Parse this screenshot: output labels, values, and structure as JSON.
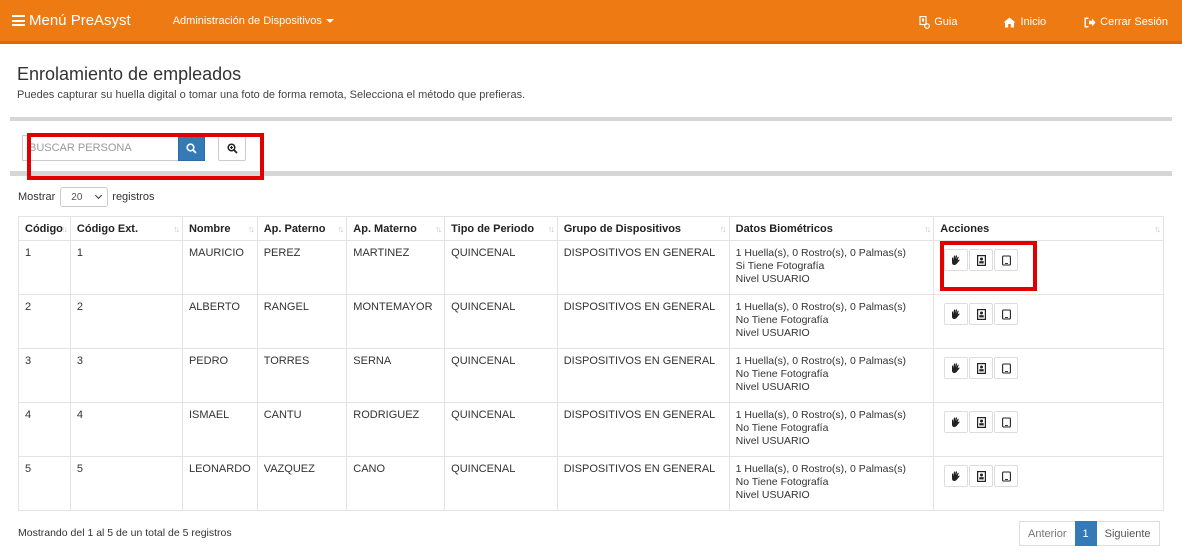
{
  "navbar": {
    "brand": "Menú PreAsyst",
    "admin_menu": "Administración de Dispositivos",
    "guide": "Guia",
    "home": "Inicio",
    "logout": "Cerrar Sesión",
    "color": "#ee7a13"
  },
  "header": {
    "title": "Enrolamiento de empleados",
    "subtitle": "Puedes capturar su huella digital o tomar una foto de forma remota, Selecciona el método que prefieras."
  },
  "search": {
    "placeholder": "BUSCAR PERSONA"
  },
  "length": {
    "prefix": "Mostrar",
    "value": "20",
    "suffix": "registros"
  },
  "table": {
    "columns": [
      "Código",
      "Código Ext.",
      "Nombre",
      "Ap. Paterno",
      "Ap. Materno",
      "Tipo de Periodo",
      "Grupo de Dispositivos",
      "Datos Biométricos",
      "Acciones"
    ],
    "rows": [
      {
        "codigo": "1",
        "codigo_ext": "1",
        "nombre": "MAURICIO",
        "paterno": "PEREZ",
        "materno": "MARTINEZ",
        "periodo": "QUINCENAL",
        "grupo": "DISPOSITIVOS EN GENERAL",
        "bio1": "1 Huella(s), 0 Rostro(s), 0 Palmas(s)",
        "bio2": "Si Tiene Fotografía",
        "bio3": "Nivel USUARIO"
      },
      {
        "codigo": "2",
        "codigo_ext": "2",
        "nombre": "ALBERTO",
        "paterno": "RANGEL",
        "materno": "MONTEMAYOR",
        "periodo": "QUINCENAL",
        "grupo": "DISPOSITIVOS EN GENERAL",
        "bio1": "1 Huella(s), 0 Rostro(s), 0 Palmas(s)",
        "bio2": "No Tiene Fotografía",
        "bio3": "Nivel USUARIO"
      },
      {
        "codigo": "3",
        "codigo_ext": "3",
        "nombre": "PEDRO",
        "paterno": "TORRES",
        "materno": "SERNA",
        "periodo": "QUINCENAL",
        "grupo": "DISPOSITIVOS EN GENERAL",
        "bio1": "1 Huella(s), 0 Rostro(s), 0 Palmas(s)",
        "bio2": "No Tiene Fotografía",
        "bio3": "Nivel USUARIO"
      },
      {
        "codigo": "4",
        "codigo_ext": "4",
        "nombre": "ISMAEL",
        "paterno": "CANTU",
        "materno": "RODRIGUEZ",
        "periodo": "QUINCENAL",
        "grupo": "DISPOSITIVOS EN GENERAL",
        "bio1": "1 Huella(s), 0 Rostro(s), 0 Palmas(s)",
        "bio2": "No Tiene Fotografía",
        "bio3": "Nivel USUARIO"
      },
      {
        "codigo": "5",
        "codigo_ext": "5",
        "nombre": "LEONARDO",
        "paterno": "VAZQUEZ",
        "materno": "CANO",
        "periodo": "QUINCENAL",
        "grupo": "DISPOSITIVOS EN GENERAL",
        "bio1": "1 Huella(s), 0 Rostro(s), 0 Palmas(s)",
        "bio2": "No Tiene Fotografía",
        "bio3": "Nivel USUARIO"
      }
    ],
    "action_icons": [
      "hand-icon",
      "id-card-icon",
      "tablet-icon"
    ]
  },
  "footer": {
    "info": "Mostrando del 1 al 5 de un total de 5 registros",
    "prev": "Anterior",
    "current_page": "1",
    "next": "Siguiente"
  },
  "accent_colors": {
    "primary": "#337ab7",
    "highlight_box": "#e00000"
  }
}
